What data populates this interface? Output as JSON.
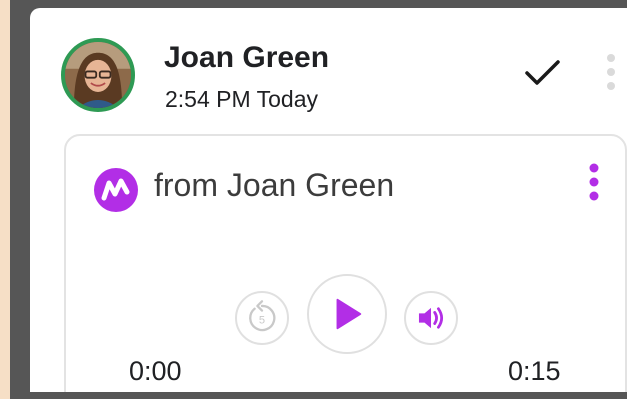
{
  "message": {
    "sender_name": "Joan Green",
    "timestamp": "2:54 PM Today",
    "avatar_icon": "user-photo-icon",
    "status_icon": "checkmark-icon",
    "menu_icon": "more-vert-icon"
  },
  "voice_card": {
    "app_icon": "wavy-m-logo-icon",
    "from_label": "from Joan Green",
    "menu_icon": "more-vert-icon",
    "controls": {
      "rewind_icon": "rewind-5-icon",
      "rewind_number": "5",
      "play_icon": "play-icon",
      "volume_icon": "volume-icon"
    },
    "time_current": "0:00",
    "time_total": "0:15"
  },
  "colors": {
    "accent_purple": "#b22ee6",
    "avatar_ring": "#2e9a54",
    "page_background": "#f6dfc6",
    "frame": "#565656"
  }
}
